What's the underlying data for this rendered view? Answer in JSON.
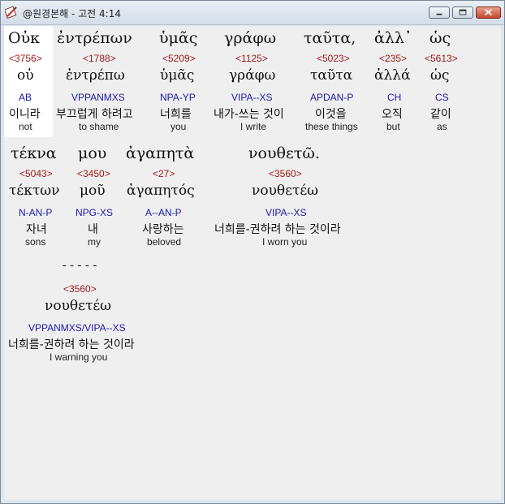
{
  "window": {
    "title": "@원경본해 - 고전 4:14",
    "icon": "book-pencil-icon",
    "buttons": {
      "minimize": "minimize-icon",
      "maximize": "maximize-icon",
      "close": "close-icon"
    }
  },
  "colors": {
    "strong": "#a01818",
    "parse": "#1a1aa8",
    "background": "#efefef",
    "selected": "#ffffff"
  },
  "rows": [
    {
      "words": [
        {
          "greek": "Οὐκ",
          "strong": "<3756>",
          "lemma": "οὐ",
          "parse": "AB",
          "korean": "이니라",
          "english": "not"
        },
        {
          "greek": "ἐντρέπων",
          "strong": "<1788>",
          "lemma": "ἐντρέπω",
          "parse": "VPPANMXS",
          "korean": "부끄럽게 하려고",
          "english": "to shame"
        },
        {
          "greek": "ὑμᾶς",
          "strong": "<5209>",
          "lemma": "ὑμᾶς",
          "parse": "NPA-YP",
          "korean": "너희를",
          "english": "you"
        },
        {
          "greek": "γράφω",
          "strong": "<1125>",
          "lemma": "γράφω",
          "parse": "VIPA--XS",
          "korean": "내가-쓰는 것이",
          "english": "I write"
        },
        {
          "greek": "ταῦτα,",
          "strong": "<5023>",
          "lemma": "ταῦτα",
          "parse": "APDAN-P",
          "korean": "이것을",
          "english": "these things"
        },
        {
          "greek": "ἀλλ᾽",
          "strong": "<235>",
          "lemma": "ἀλλά",
          "parse": "CH",
          "korean": "오직",
          "english": "but"
        },
        {
          "greek": "ὡς",
          "strong": "<5613>",
          "lemma": "ὡς",
          "parse": "CS",
          "korean": "같이",
          "english": "as"
        }
      ]
    },
    {
      "words": [
        {
          "greek": "τέκνα",
          "strong": "<5043>",
          "lemma": "τέκτων",
          "parse": "N-AN-P",
          "korean": "자녀",
          "english": "sons"
        },
        {
          "greek": "μου",
          "strong": "<3450>",
          "lemma": "μοῦ",
          "parse": "NPG-XS",
          "korean": "내",
          "english": "my"
        },
        {
          "greek": "ἀγαπητὰ",
          "strong": "<27>",
          "lemma": "ἀγαπητός",
          "parse": "A--AN-P",
          "korean": "사랑하는",
          "english": "beloved"
        },
        {
          "greek": "νουθετῶ.",
          "strong": "<3560>",
          "lemma": "νουθετέω",
          "parse": "VIPA--XS",
          "korean": "너희를-권하려 하는 것이라",
          "english": "I worn you"
        }
      ]
    },
    {
      "words": [
        {
          "greek": "-----",
          "strong": "<3560>",
          "lemma": "νουθετέω",
          "parse": "VPPANMXS/VIPA--XS",
          "korean": "너희를-권하려 하는 것이라",
          "english": "I warning you"
        }
      ]
    }
  ]
}
